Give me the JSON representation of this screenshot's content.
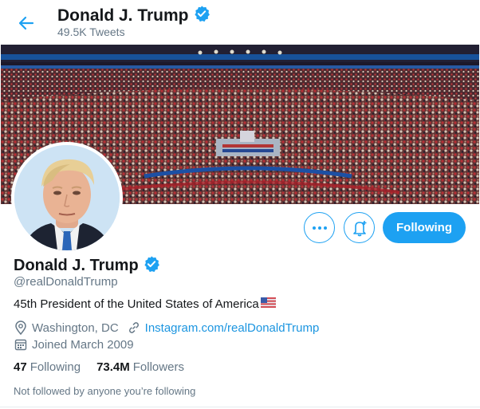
{
  "header": {
    "name": "Donald J. Trump",
    "tweet_count": "49.5K Tweets"
  },
  "profile": {
    "name": "Donald J. Trump",
    "handle": "@realDonaldTrump",
    "bio": "45th President of the United States of America",
    "location": "Washington, DC",
    "website": "Instagram.com/realDonaldTrump",
    "joined": "Joined March 2009",
    "following_count": "47",
    "following_label": "Following",
    "followers_count": "73.4M",
    "followers_label": "Followers",
    "not_followed_text": "Not followed by anyone you’re following"
  },
  "actions": {
    "following_button": "Following"
  },
  "icons": {
    "back": "arrow-left-icon",
    "verified": "verified-badge-icon",
    "more": "more-dots-icon",
    "notify": "bell-plus-icon",
    "location": "location-pin-icon",
    "link": "link-icon",
    "calendar": "calendar-icon",
    "flag": "us-flag-icon"
  },
  "colors": {
    "accent": "#1da1f2",
    "link": "#1b95e0",
    "secondary_text": "#657786"
  }
}
